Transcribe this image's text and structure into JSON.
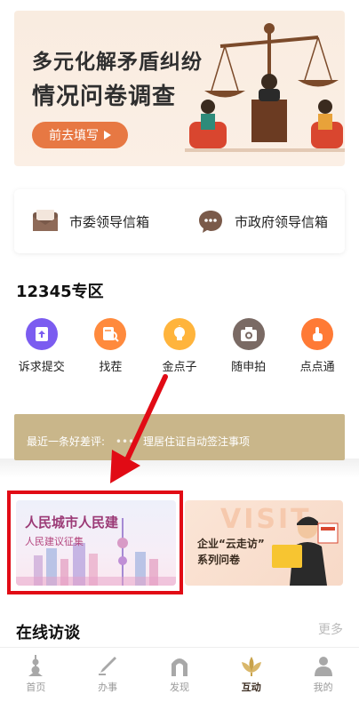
{
  "banner": {
    "title_line1": "多元化解矛盾纠纷",
    "title_line2": "情况问卷调查",
    "button_label": "前去填写"
  },
  "mailbox": {
    "items": [
      {
        "label": "市委领导信箱",
        "icon": "mail-envelope-icon"
      },
      {
        "label": "市政府领导信箱",
        "icon": "chat-bubble-icon"
      }
    ]
  },
  "zone12345": {
    "title": "12345专区",
    "items": [
      {
        "label": "诉求提交",
        "icon": "upload-doc-icon",
        "color": "#7b5cf0"
      },
      {
        "label": "找茬",
        "icon": "search-doc-icon",
        "color": "#ff8a3d"
      },
      {
        "label": "金点子",
        "icon": "lightbulb-icon",
        "color": "#ffb43c"
      },
      {
        "label": "随申拍",
        "icon": "camera-icon",
        "color": "#7a6a64"
      },
      {
        "label": "点点通",
        "icon": "tap-hand-icon",
        "color": "#ff7a35"
      }
    ]
  },
  "review": {
    "prefix": "最近一条好差评:",
    "dots": "•••",
    "text": "理居住证自动签注事项"
  },
  "cards": {
    "left": {
      "title": "人民城市人民建",
      "subtitle": "人民建议征集"
    },
    "right": {
      "visit": "VISIT",
      "line1": "企业“云走访”",
      "line2": "系列问卷"
    }
  },
  "interview": {
    "title": "在线访谈",
    "more": "更多"
  },
  "tabbar": {
    "items": [
      {
        "label": "首页",
        "icon": "tower-icon",
        "active": false
      },
      {
        "label": "办事",
        "icon": "pen-icon",
        "active": false
      },
      {
        "label": "发现",
        "icon": "arch-icon",
        "active": false
      },
      {
        "label": "互动",
        "icon": "flower-icon",
        "active": true
      },
      {
        "label": "我的",
        "icon": "person-icon",
        "active": false
      }
    ]
  },
  "colors": {
    "accent_orange": "#e77843",
    "review_bar": "#c9b68a",
    "highlight_red": "#e10b15"
  }
}
